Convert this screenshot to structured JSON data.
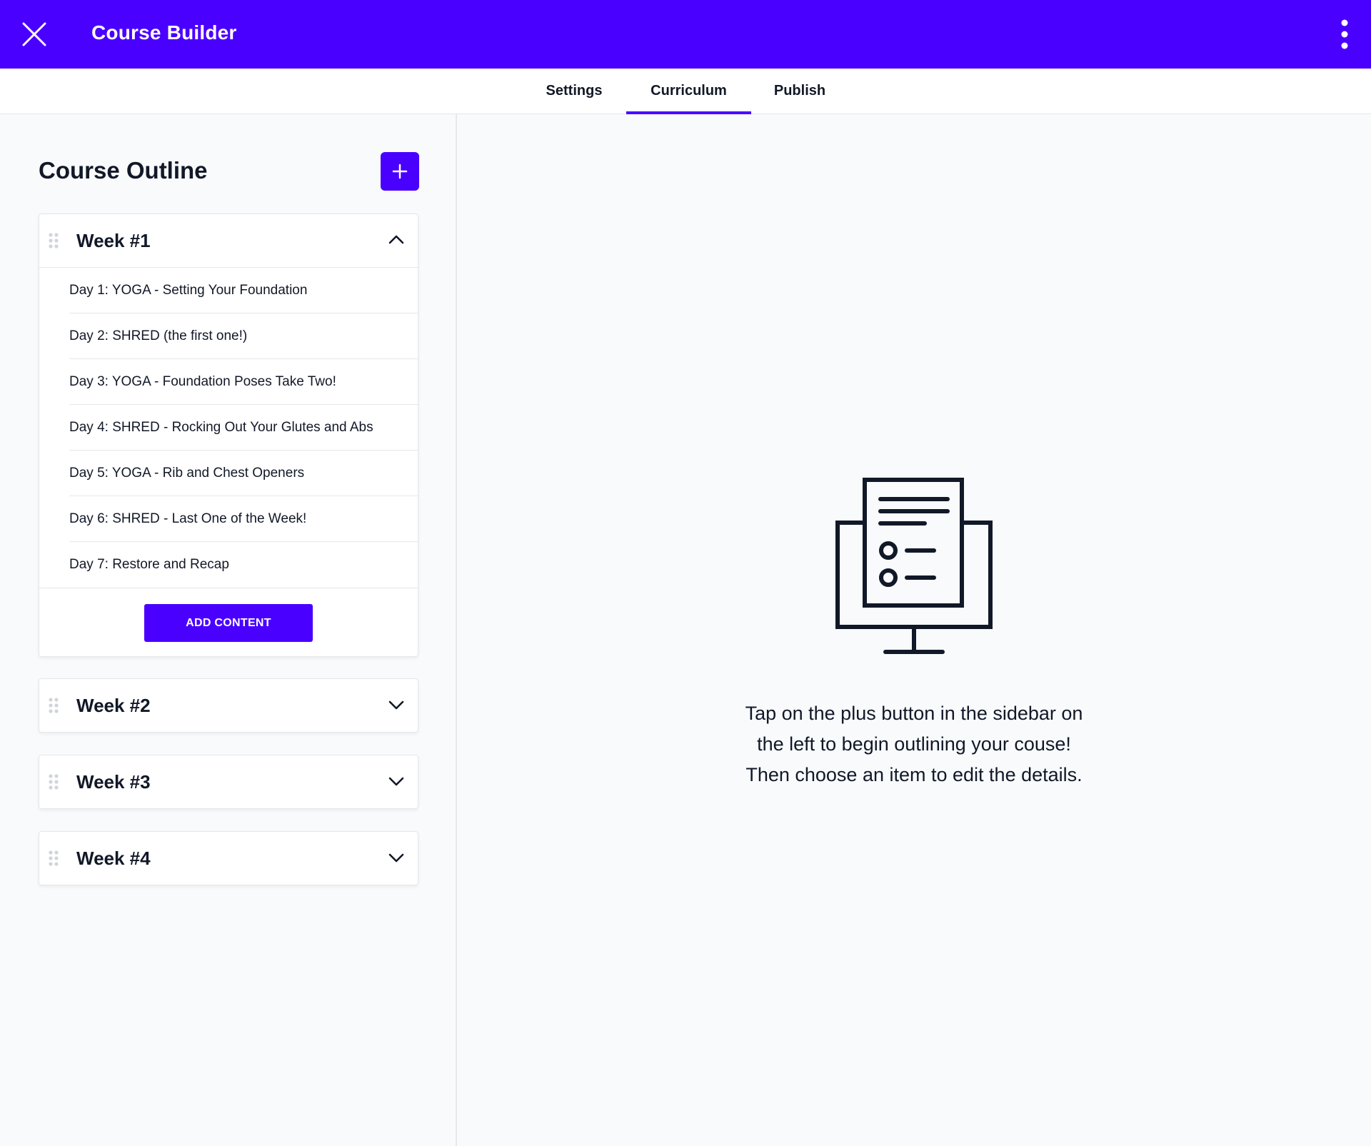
{
  "header": {
    "title": "Course Builder",
    "close_icon": "close-icon",
    "menu_icon": "kebab-menu-icon",
    "background": "#4a00ff"
  },
  "tabs": [
    {
      "label": "Settings",
      "active": false
    },
    {
      "label": "Curriculum",
      "active": true
    },
    {
      "label": "Publish",
      "active": false
    }
  ],
  "sidebar": {
    "title": "Course Outline",
    "add_icon": "plus-icon",
    "weeks": [
      {
        "title": "Week #1",
        "expanded": true,
        "items": [
          "Day 1: YOGA - Setting Your Foundation",
          "Day 2: SHRED (the first one!)",
          "Day 3: YOGA - Foundation Poses Take Two!",
          "Day 4: SHRED - Rocking Out Your Glutes and Abs",
          "Day 5: YOGA - Rib and Chest Openers",
          "Day 6: SHRED - Last One of the Week!",
          "Day 7: Restore and Recap"
        ],
        "add_content_label": "ADD CONTENT"
      },
      {
        "title": "Week #2",
        "expanded": false
      },
      {
        "title": "Week #3",
        "expanded": false
      },
      {
        "title": "Week #4",
        "expanded": false
      }
    ]
  },
  "main": {
    "illustration": "monitor-document-icon",
    "message_lines": [
      "Tap on the plus button in the sidebar on",
      "the left to begin outlining your couse!",
      "Then choose an item to edit the details."
    ]
  },
  "colors": {
    "accent": "#4a00ff",
    "text": "#111827",
    "background": "#f8fafc",
    "border": "#e5e7eb"
  }
}
